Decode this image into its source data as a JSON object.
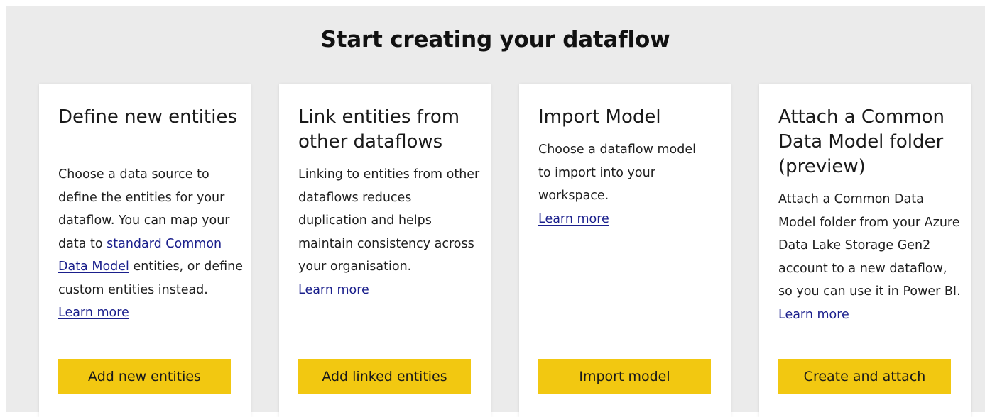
{
  "page": {
    "title": "Start creating your dataflow"
  },
  "cards": {
    "define": {
      "title": "Define new entities",
      "desc_1": "Choose a data source to define the entities for your dataflow. You can map your data to ",
      "desc_link": "standard Common Data Model",
      "desc_2": " entities, or define custom entities instead.",
      "learn_more": "Learn more",
      "button": "Add new entities"
    },
    "link": {
      "title": "Link entities from other dataflows",
      "desc": "Linking to entities from other dataflows reduces duplication and helps maintain consistency across your organisation.",
      "learn_more": "Learn more",
      "button": "Add linked entities"
    },
    "import": {
      "title": "Import Model",
      "desc": "Choose a dataflow model to import into your workspace.",
      "learn_more": "Learn more",
      "button": "Import model"
    },
    "attach": {
      "title": "Attach a Common Data Model folder (preview)",
      "desc": "Attach a Common Data Model folder from your Azure Data Lake Storage Gen2 account to a new dataflow, so you can use it in Power BI.",
      "learn_more": "Learn more",
      "button": "Create and attach"
    }
  },
  "colors": {
    "accent": "#f2c811",
    "link": "#1a1f8c",
    "background": "#ebebeb"
  }
}
